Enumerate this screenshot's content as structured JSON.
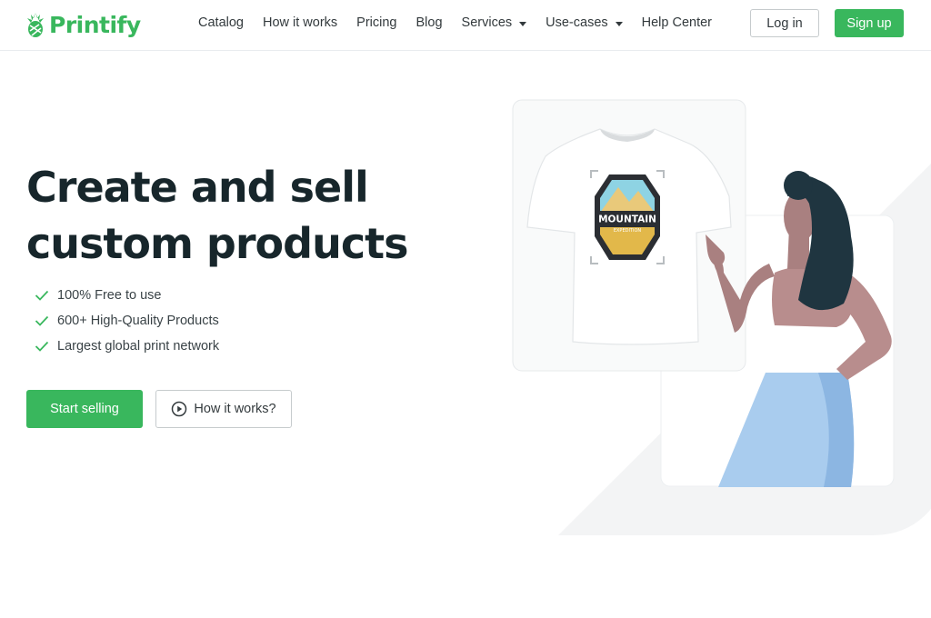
{
  "brand": {
    "name": "Printify",
    "color": "#39b75d"
  },
  "nav": {
    "items": [
      {
        "label": "Catalog",
        "dropdown": false
      },
      {
        "label": "How it works",
        "dropdown": false
      },
      {
        "label": "Pricing",
        "dropdown": false
      },
      {
        "label": "Blog",
        "dropdown": false
      },
      {
        "label": "Services",
        "dropdown": true
      },
      {
        "label": "Use-cases",
        "dropdown": true
      },
      {
        "label": "Help Center",
        "dropdown": false
      }
    ],
    "login_label": "Log in",
    "signup_label": "Sign up"
  },
  "hero": {
    "title_line1": "Create and sell",
    "title_line2": "custom products",
    "features": [
      "100% Free to use",
      "600+ High-Quality Products",
      "Largest global print network"
    ],
    "primary_cta": "Start selling",
    "secondary_cta": "How it works?"
  },
  "illustration": {
    "badge_title": "MOUNTAIN",
    "badge_subtitle": "EXPEDITION",
    "icons": {
      "logo": "pineapple-logo-icon",
      "check": "check-icon",
      "play": "play-circle-icon"
    }
  },
  "colors": {
    "accent": "#39b75d",
    "text": "#17262b",
    "border": "#c6cbcd"
  }
}
